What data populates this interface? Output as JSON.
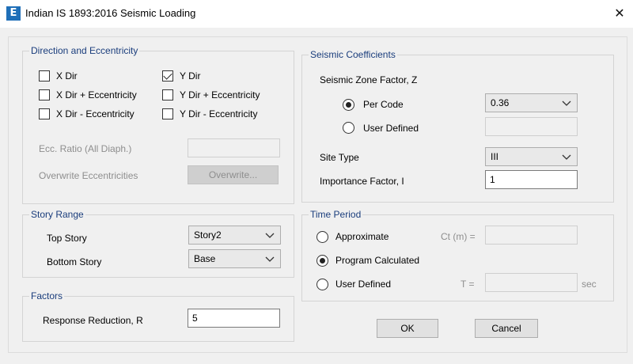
{
  "window": {
    "title": "Indian IS 1893:2016 Seismic Loading",
    "app_icon_letter": "E"
  },
  "direction": {
    "legend": "Direction and Eccentricity",
    "checkboxes": [
      {
        "label": "X Dir",
        "checked": false
      },
      {
        "label": "X Dir + Eccentricity",
        "checked": false
      },
      {
        "label": "X Dir - Eccentricity",
        "checked": false
      },
      {
        "label": "Y Dir",
        "checked": true
      },
      {
        "label": "Y Dir + Eccentricity",
        "checked": false
      },
      {
        "label": "Y Dir - Eccentricity",
        "checked": false
      }
    ],
    "ecc_ratio_label": "Ecc. Ratio (All Diaph.)",
    "ecc_ratio_value": "",
    "overwrite_label": "Overwrite Eccentricities",
    "overwrite_button": "Overwrite..."
  },
  "story_range": {
    "legend": "Story Range",
    "top_story_label": "Top Story",
    "top_story_value": "Story2",
    "bottom_story_label": "Bottom Story",
    "bottom_story_value": "Base"
  },
  "factors": {
    "legend": "Factors",
    "response_reduction_label": "Response Reduction, R",
    "response_reduction_value": "5"
  },
  "seismic": {
    "legend": "Seismic Coefficients",
    "zone_factor_label": "Seismic Zone Factor, Z",
    "per_code_label": "Per Code",
    "per_code_selected": true,
    "per_code_value": "0.36",
    "user_defined_label": "User Defined",
    "user_defined_value": "",
    "site_type_label": "Site Type",
    "site_type_value": "III",
    "importance_label": "Importance Factor, I",
    "importance_value": "1"
  },
  "time_period": {
    "legend": "Time Period",
    "approximate_label": "Approximate",
    "ct_label": "Ct (m) =",
    "ct_value": "",
    "program_calculated_label": "Program Calculated",
    "program_calculated_selected": true,
    "user_defined_label": "User Defined",
    "t_label": "T =",
    "t_value": "",
    "t_unit": "sec"
  },
  "buttons": {
    "ok": "OK",
    "cancel": "Cancel"
  }
}
